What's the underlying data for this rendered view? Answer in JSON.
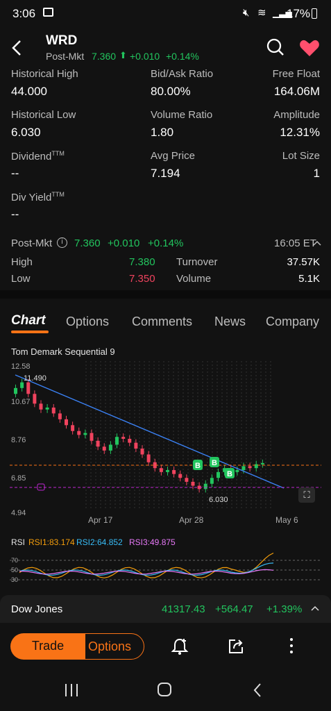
{
  "status": {
    "time": "3:06",
    "battery": "17%"
  },
  "header": {
    "ticker": "WRD",
    "post_label": "Post-Mkt",
    "post_price": "7.360",
    "post_change": "+0.010",
    "post_pct": "+0.14%"
  },
  "stats": [
    {
      "label": "Historical High",
      "value": "44.000"
    },
    {
      "label": "Bid/Ask Ratio",
      "value": "80.00%"
    },
    {
      "label": "Free Float",
      "value": "164.06M"
    },
    {
      "label": "Historical Low",
      "value": "6.030"
    },
    {
      "label": "Volume Ratio",
      "value": "1.80"
    },
    {
      "label": "Amplitude",
      "value": "12.31%"
    },
    {
      "label": "Dividend",
      "sup": "TTM",
      "value": "--"
    },
    {
      "label": "Avg Price",
      "value": "7.194"
    },
    {
      "label": "Lot Size",
      "value": "1"
    },
    {
      "label": "Div Yield",
      "sup": "TTM",
      "value": "--"
    }
  ],
  "postmkt": {
    "label": "Post-Mkt",
    "price": "7.360",
    "change": "+0.010",
    "pct": "+0.14%",
    "time": "16:05 ET",
    "high_label": "High",
    "high": "7.380",
    "low_label": "Low",
    "low": "7.350",
    "turnover_label": "Turnover",
    "turnover": "37.57K",
    "volume_label": "Volume",
    "volume": "5.1K"
  },
  "tabs": [
    "Chart",
    "Options",
    "Comments",
    "News",
    "Company"
  ],
  "chart": {
    "indicator_title": "Tom Demark Sequential 9",
    "y_ticks": [
      "12.58",
      "10.67",
      "8.76",
      "6.85",
      "4.94"
    ],
    "x_ticks": [
      "Apr 17",
      "Apr 28",
      "May 6"
    ],
    "max_label": "11.490",
    "min_label": "6.030",
    "buy_label": "B"
  },
  "chart_data": {
    "type": "candlestick",
    "ylim": [
      4.94,
      12.58
    ],
    "y_ticks": [
      12.58,
      10.67,
      8.76,
      6.85,
      4.94
    ],
    "x_ticks": [
      "Apr 17",
      "Apr 28",
      "May 6"
    ],
    "annotations": {
      "period_high": 11.49,
      "period_low": 6.03
    },
    "closes": [
      11.2,
      11.49,
      10.9,
      10.4,
      10.1,
      10.2,
      9.9,
      9.6,
      9.3,
      9.0,
      8.8,
      8.9,
      8.5,
      8.2,
      8.0,
      8.3,
      8.7,
      8.6,
      8.4,
      8.1,
      7.8,
      7.4,
      7.1,
      6.9,
      7.0,
      6.8,
      6.6,
      6.4,
      6.2,
      6.03,
      6.3,
      6.6,
      6.9,
      7.1,
      6.9,
      7.0,
      7.2,
      7.1,
      7.3,
      7.36
    ],
    "rsi": {
      "labels": [
        "RSI",
        "RSI1:83.174",
        "RSI2:64.852",
        "RSI3:49.875"
      ],
      "levels": [
        70,
        50,
        30
      ],
      "values": {
        "rsi1": 83.174,
        "rsi2": 64.852,
        "rsi3": 49.875
      }
    }
  },
  "ticker_bar": {
    "name": "Dow Jones",
    "price": "41317.43",
    "change": "+564.47",
    "pct": "+1.39%"
  },
  "bottom_bar": {
    "trade": "Trade",
    "options": "Options"
  },
  "colors": {
    "up": "#22c55e",
    "down": "#f0435e",
    "accent": "#f97316",
    "bg": "#121212"
  }
}
